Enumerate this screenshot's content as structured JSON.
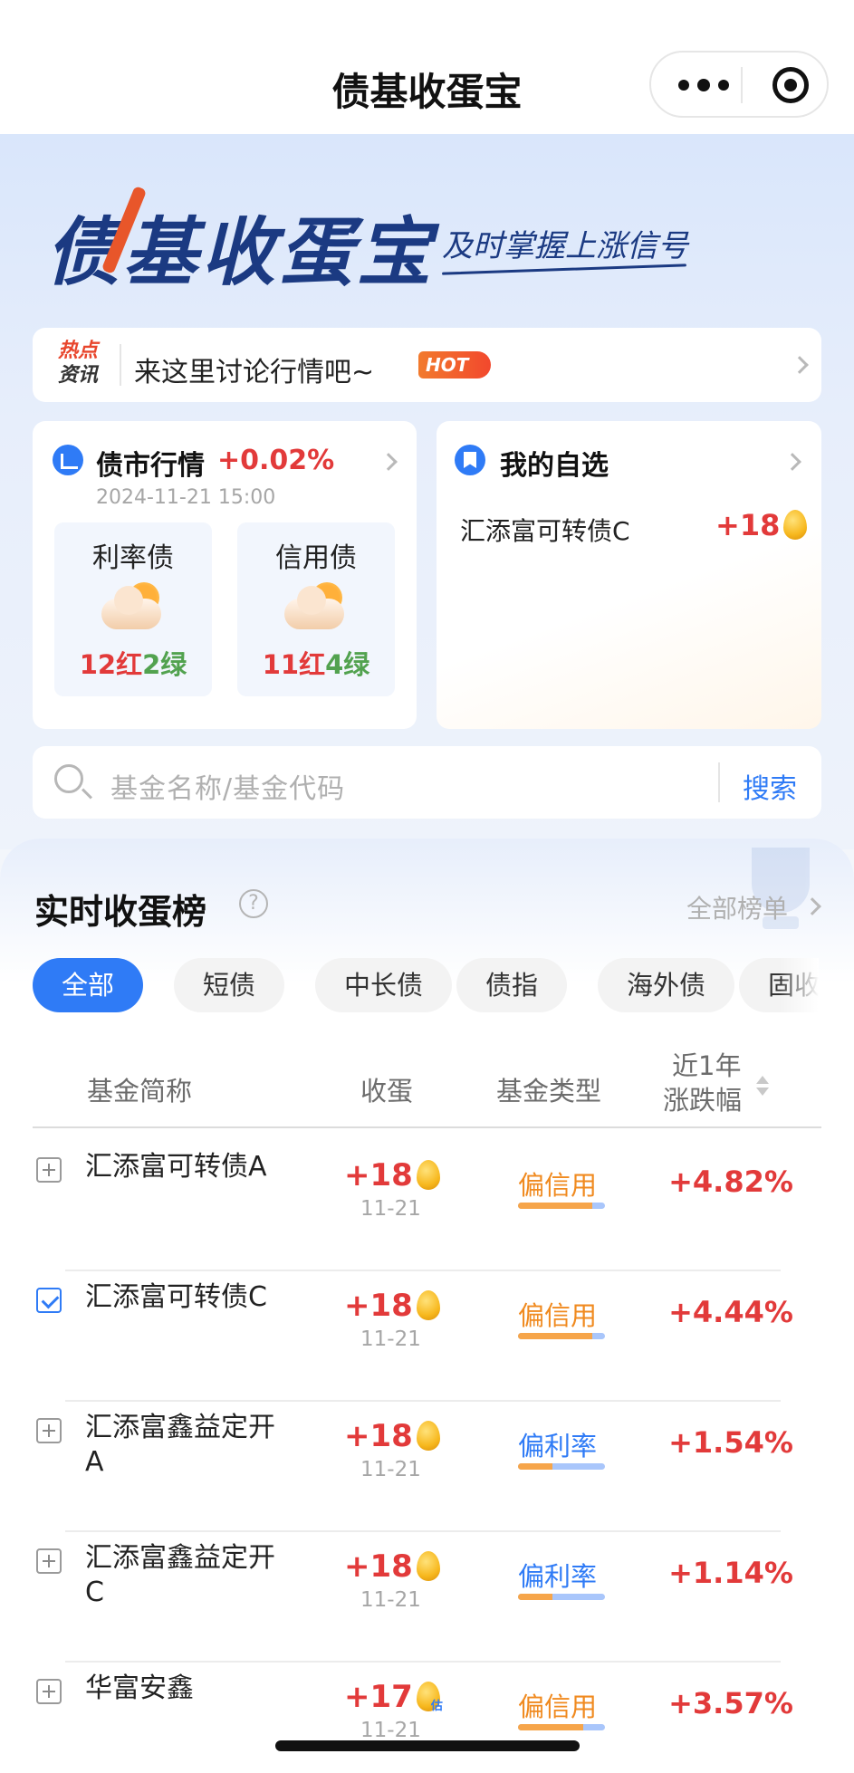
{
  "nav": {
    "title": "债基收蛋宝"
  },
  "banner": {
    "logo": "债基收蛋宝",
    "slogan": "及时掌握上涨信号"
  },
  "news": {
    "tag_line1": "热点",
    "tag_line2": "资讯",
    "text": "来这里讨论行情吧~",
    "badge": "HOT"
  },
  "market": {
    "title": "债市行情",
    "change": "+0.02%",
    "time": "2024-11-21 15:00",
    "boxes": [
      {
        "name": "利率债",
        "red": "12红",
        "green": "2绿"
      },
      {
        "name": "信用债",
        "red": "11红",
        "green": "4绿"
      }
    ]
  },
  "watchlist": {
    "title": "我的自选",
    "fund": "汇添富可转债C",
    "value": "+18"
  },
  "search": {
    "placeholder": "基金名称/基金代码",
    "button": "搜索"
  },
  "ranking": {
    "title": "实时收蛋榜",
    "help": "?",
    "all_label": "全部榜单",
    "chips": [
      "全部",
      "短债",
      "中长债",
      "债指",
      "海外债",
      "固收+"
    ],
    "headers": {
      "name": "基金简称",
      "eggs": "收蛋",
      "type": "基金类型",
      "change_line1": "近1年",
      "change_line2": "涨跌幅"
    },
    "rows": [
      {
        "name": "汇添富可转债A",
        "eggs": "+18",
        "date": "11-21",
        "type": "偏信用",
        "type_kind": "credit",
        "credit_share": 0.85,
        "change": "+4.82%",
        "checked": false,
        "estimated": false
      },
      {
        "name": "汇添富可转债C",
        "eggs": "+18",
        "date": "11-21",
        "type": "偏信用",
        "type_kind": "credit",
        "credit_share": 0.85,
        "change": "+4.44%",
        "checked": true,
        "estimated": false
      },
      {
        "name": "汇添富鑫益定开A",
        "eggs": "+18",
        "date": "11-21",
        "type": "偏利率",
        "type_kind": "rate",
        "credit_share": 0.4,
        "change": "+1.54%",
        "checked": false,
        "estimated": false
      },
      {
        "name": "汇添富鑫益定开C",
        "eggs": "+18",
        "date": "11-21",
        "type": "偏利率",
        "type_kind": "rate",
        "credit_share": 0.4,
        "change": "+1.14%",
        "checked": false,
        "estimated": false
      },
      {
        "name": "华富安鑫",
        "eggs": "+17",
        "date": "11-21",
        "type": "偏信用",
        "type_kind": "credit",
        "credit_share": 0.75,
        "change": "+3.57%",
        "checked": false,
        "estimated": true,
        "estimated_label": "估"
      }
    ]
  },
  "colors": {
    "accent": "#2f7bf6",
    "up_red": "#e23a3a",
    "down_green": "#52a24f",
    "credit_orange": "#f08a1f"
  }
}
